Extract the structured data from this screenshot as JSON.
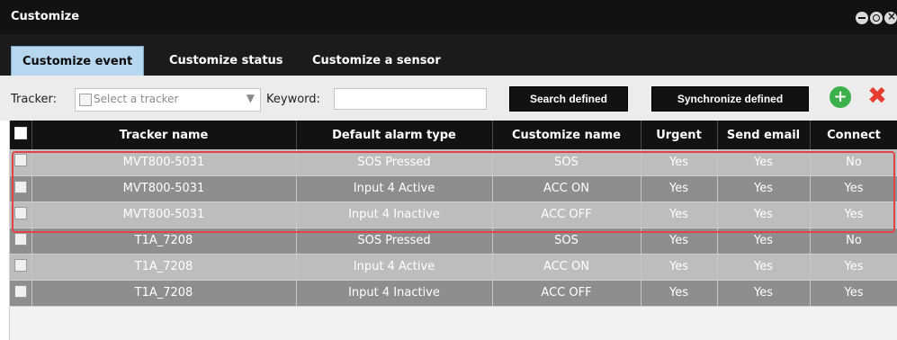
{
  "window": {
    "title": "Customize"
  },
  "tabs": [
    {
      "label": "Customize event"
    },
    {
      "label": "Customize status"
    },
    {
      "label": "Customize a sensor"
    }
  ],
  "filters": {
    "tracker_label": "Tracker:",
    "tracker_placeholder": "Select a tracker",
    "keyword_label": "Keyword:",
    "keyword_value": ""
  },
  "buttons": {
    "search": "Search defined",
    "sync": "Synchronize defined"
  },
  "icons": {
    "add": "add-icon",
    "delete": "delete-icon",
    "minimize": "minimize-icon",
    "maximize": "maximize-icon",
    "close": "close-icon"
  },
  "colors": {
    "titlebar": "#121212",
    "active_tab": "#b7d7ef",
    "row_light": "#bdbdbd",
    "row_dark": "#8e8e8e",
    "highlight": "#e0444b",
    "add_green": "#3bb04b",
    "delete_red": "#e53d2f"
  },
  "table": {
    "headers": [
      "Tracker name",
      "Default alarm type",
      "Customize name",
      "Urgent",
      "Send email",
      "Connect"
    ],
    "rows": [
      [
        "MVT800-5031",
        "SOS Pressed",
        "SOS",
        "Yes",
        "Yes",
        "No"
      ],
      [
        "MVT800-5031",
        "Input 4 Active",
        "ACC ON",
        "Yes",
        "Yes",
        "Yes"
      ],
      [
        "MVT800-5031",
        "Input 4 Inactive",
        "ACC OFF",
        "Yes",
        "Yes",
        "Yes"
      ],
      [
        "T1A_7208",
        "SOS Pressed",
        "SOS",
        "Yes",
        "Yes",
        "No"
      ],
      [
        "T1A_7208",
        "Input 4 Active",
        "ACC ON",
        "Yes",
        "Yes",
        "Yes"
      ],
      [
        "T1A_7208",
        "Input 4 Inactive",
        "ACC OFF",
        "Yes",
        "Yes",
        "Yes"
      ]
    ]
  }
}
